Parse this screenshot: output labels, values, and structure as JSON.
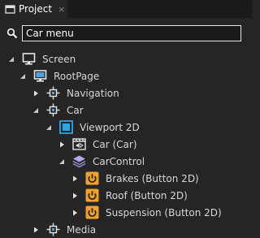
{
  "panel": {
    "tab_label": "Project",
    "tab_close": "×"
  },
  "search": {
    "value": "Car menu",
    "icon": "search-icon"
  },
  "tree": {
    "screen": "Screen",
    "rootpage": "RootPage",
    "navigation": "Navigation",
    "car": "Car",
    "viewport": "Viewport 2D",
    "car_car": "Car (Car)",
    "carcontrol": "CarControl",
    "brakes": "Brakes (Button 2D)",
    "roof": "Roof (Button 2D)",
    "suspension": "Suspension (Button 2D)",
    "media": "Media"
  },
  "colors": {
    "accent_orange": "#f0a030",
    "accent_blue": "#2aa7e8"
  }
}
